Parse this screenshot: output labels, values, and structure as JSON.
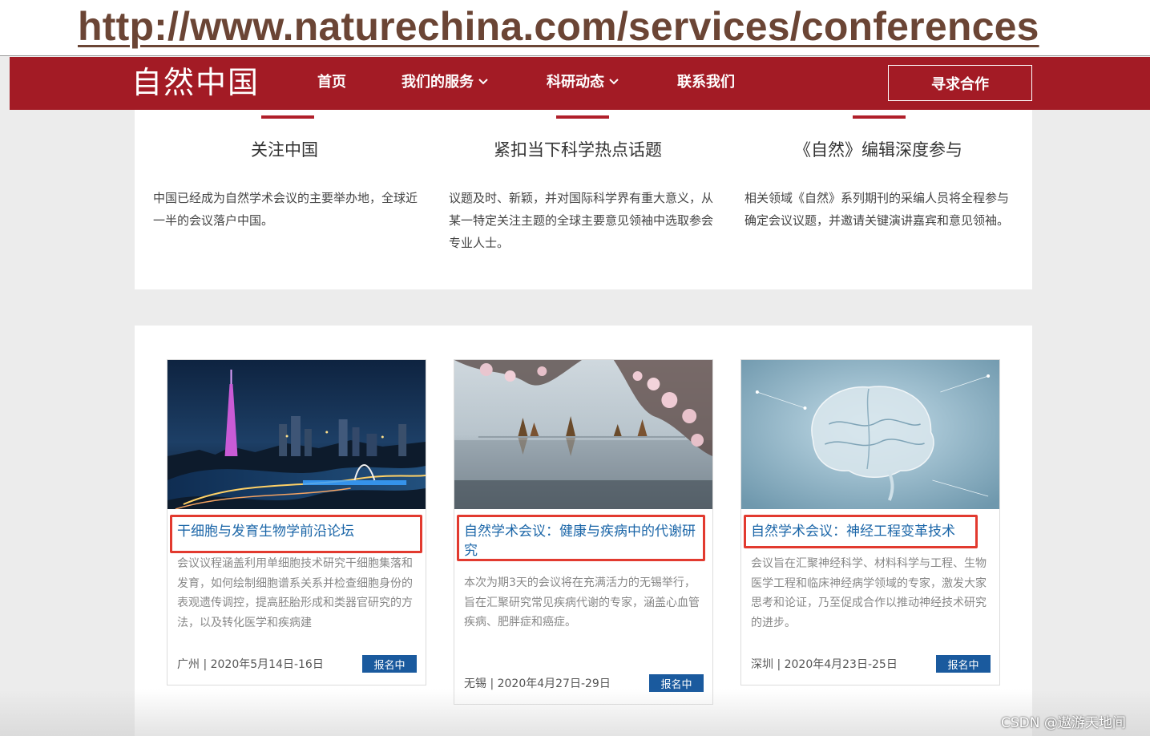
{
  "url_banner": {
    "url": "http://www.naturechina.com/services/conferences"
  },
  "nav": {
    "brand": "自然中国",
    "items": [
      {
        "label": "首页",
        "has_dropdown": false
      },
      {
        "label": "我们的服务",
        "has_dropdown": true
      },
      {
        "label": "科研动态",
        "has_dropdown": true
      },
      {
        "label": "联系我们",
        "has_dropdown": false
      }
    ],
    "cta_label": "寻求合作",
    "chevron": "⌄"
  },
  "features": [
    {
      "title": "关注中国",
      "desc": "中国已经成为自然学术会议的主要举办地，全球近一半的会议落户中国。"
    },
    {
      "title": "紧扣当下科学热点话题",
      "desc": "议题及时、新颖，并对国际科学界有重大意义，从某一特定关注主题的全球主要意见领袖中选取参会专业人士。"
    },
    {
      "title": "《自然》编辑深度参与",
      "desc": "相关领域《自然》系列期刊的采编人员将全程参与确定会议议题，并邀请关键演讲嘉宾和意见领袖。"
    }
  ],
  "cards": [
    {
      "image": "guangzhou-city-night-photo",
      "title": "干细胞与发育生物学前沿论坛",
      "desc": "会议议程涵盖利用单细胞技术研究干细胞集落和发育，如何绘制细胞谱系关系并检查细胞身份的表观遗传调控，提高胚胎形成和类器官研究的方法，以及转化医学和疾病建",
      "meta": "广州 | 2020年5月14日-16日",
      "badge": "报名中"
    },
    {
      "image": "wuxi-lake-cherry-blossom-photo",
      "title": "自然学术会议：健康与疾病中的代谢研究",
      "desc": "本次为期3天的会议将在充满活力的无锡举行，旨在汇聚研究常见疾病代谢的专家，涵盖心血管疾病、肥胖症和癌症。",
      "meta": "无锡 | 2020年4月27日-29日",
      "badge": "报名中"
    },
    {
      "image": "digital-brain-photo",
      "title": "自然学术会议：神经工程变革技术",
      "desc": "会议旨在汇聚神经科学、材料科学与工程、生物医学工程和临床神经病学领域的专家，激发大家思考和论证，乃至促成合作以推动神经技术研究的进步。",
      "meta": "深圳 | 2020年4月23日-25日",
      "badge": "报名中"
    }
  ],
  "watermark": "CSDN @遨游天地间",
  "colors": {
    "brand_red": "#a31b25",
    "link_blue": "#1b66a8",
    "badge_blue": "#1a5a9e",
    "highlight_red": "#e23a2f"
  }
}
